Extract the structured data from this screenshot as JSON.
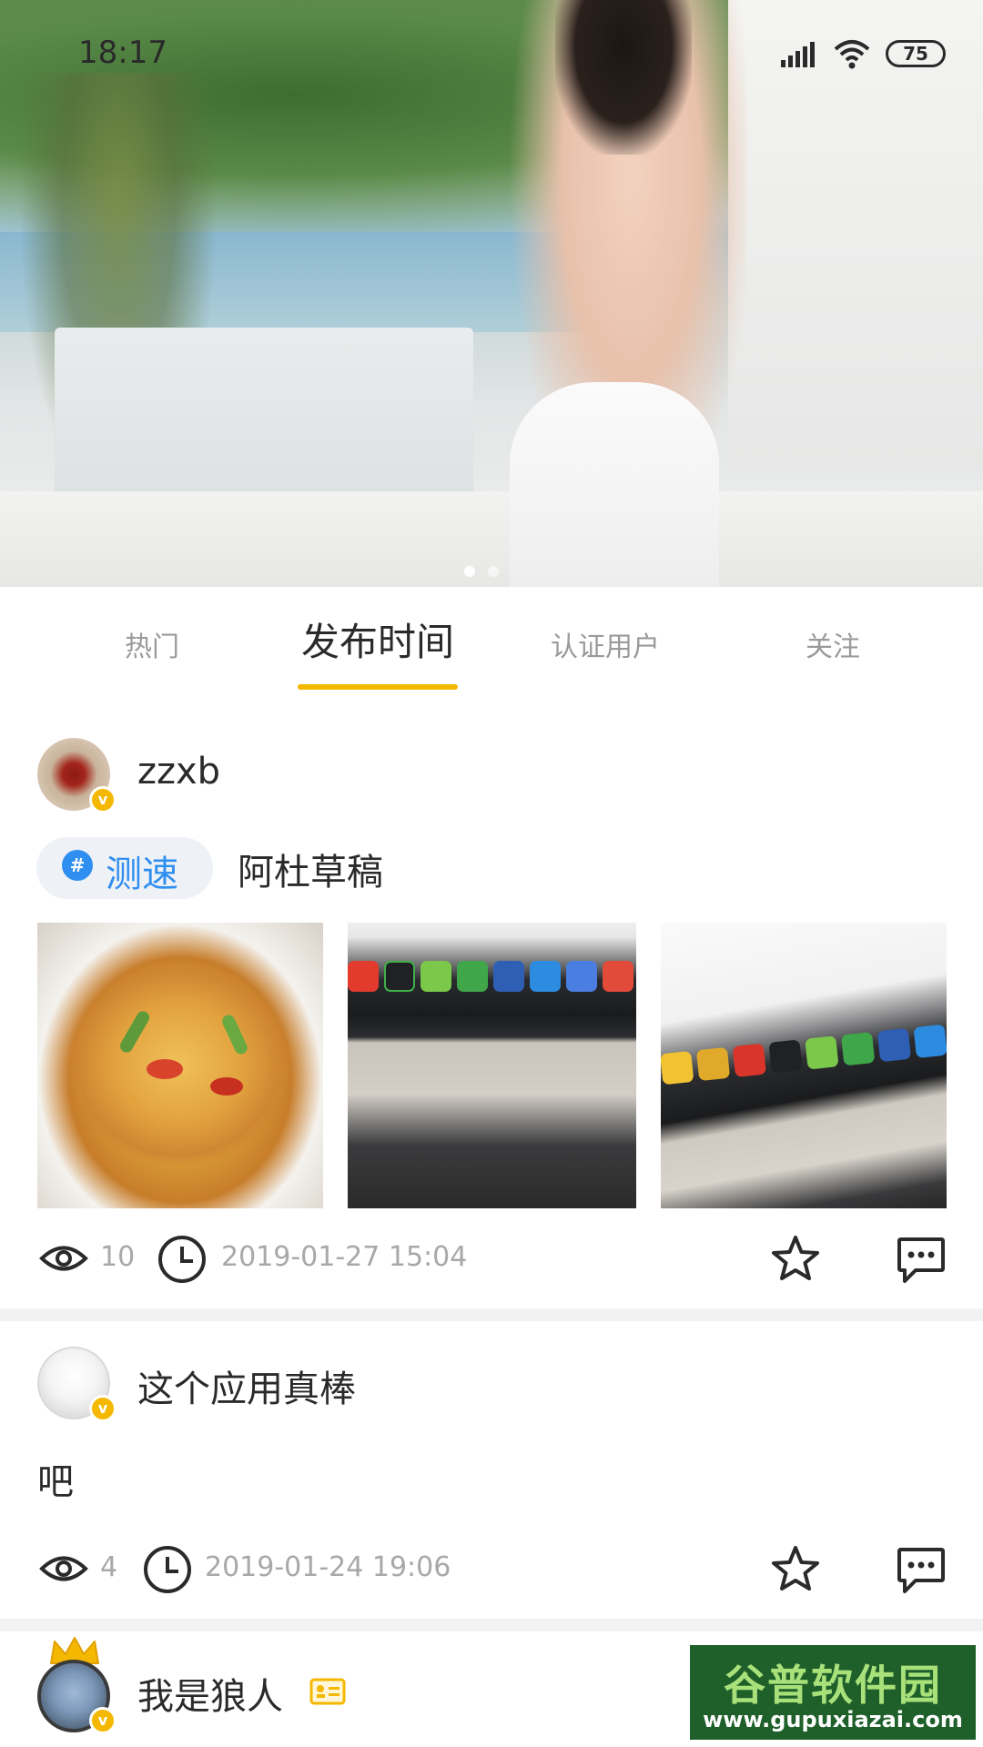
{
  "status_bar": {
    "time": "18:17",
    "battery": "75"
  },
  "tabs": [
    {
      "label": "热门",
      "active": false
    },
    {
      "label": "发布时间",
      "active": true
    },
    {
      "label": "认证用户",
      "active": false
    },
    {
      "label": "关注",
      "active": false
    }
  ],
  "accent_color": "#f5b800",
  "topic_color": "#2f8ff0",
  "posts": [
    {
      "username": "zzxb",
      "topic": "测速",
      "text": "阿杜草稿",
      "views": "10",
      "datetime": "2019-01-27 15:04",
      "image_count": 3
    },
    {
      "username": "这个应用真棒",
      "text": "吧",
      "views": "4",
      "datetime": "2019-01-24 19:06"
    },
    {
      "username": "我是狼人"
    }
  ],
  "watermark": {
    "title": "谷普软件园",
    "url": "www.gupuxiazai.com"
  },
  "icons": [
    "eye-icon",
    "clock-icon",
    "star-icon",
    "comment-icon",
    "verified-badge-icon",
    "crown-icon",
    "id-card-icon",
    "signal-icon",
    "wifi-icon",
    "battery-icon"
  ]
}
